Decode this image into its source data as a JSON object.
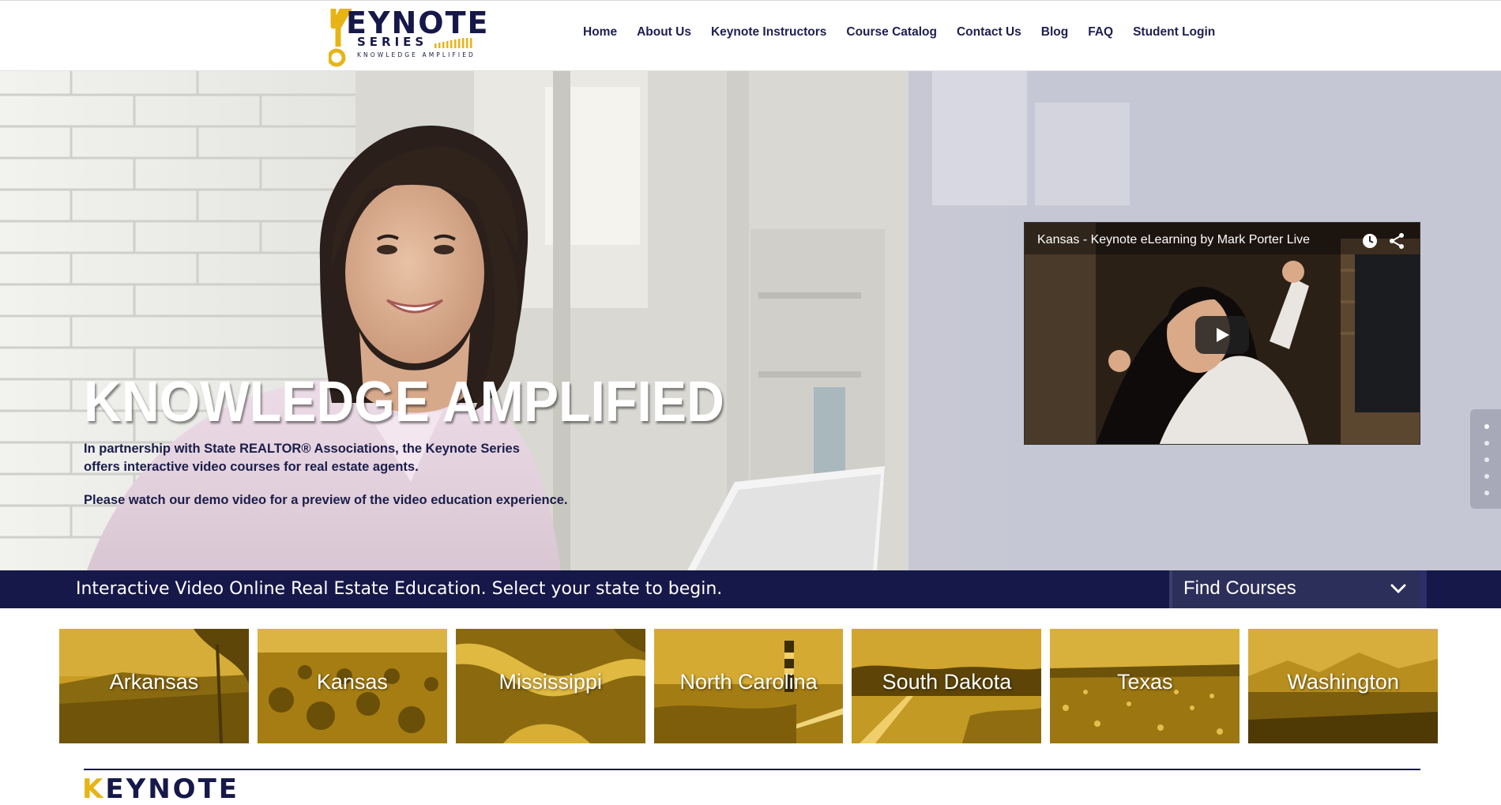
{
  "logo": {
    "word": "EYNOTE",
    "series": "SERIES",
    "tagline": "KNOWLEDGE AMPLIFIED",
    "accent_color": "#e7b416",
    "navy_color": "#16184a"
  },
  "nav": {
    "items": [
      {
        "label": "Home"
      },
      {
        "label": "About Us"
      },
      {
        "label": "Keynote Instructors"
      },
      {
        "label": "Course Catalog"
      },
      {
        "label": "Contact Us"
      },
      {
        "label": "Blog"
      },
      {
        "label": "FAQ"
      },
      {
        "label": "Student Login"
      }
    ]
  },
  "hero": {
    "title": "KNOWLEDGE AMPLIFIED",
    "paragraph1": "In partnership with State REALTOR® Associations, the Keynote Series offers interactive video courses for real estate agents.",
    "paragraph2": "Please watch our demo video for a preview of the video education experience."
  },
  "video": {
    "title": "Kansas - Keynote eLearning by Mark Porter Live",
    "icons": [
      "watch-later-icon",
      "share-icon",
      "play-icon"
    ]
  },
  "slider": {
    "dot_count": 5,
    "active_index": 0
  },
  "state_bar": {
    "text": "Interactive Video Online Real Estate Education. Select your state to begin.",
    "dropdown_label": "Find Courses"
  },
  "states": [
    {
      "name": "Arkansas"
    },
    {
      "name": "Kansas"
    },
    {
      "name": "Mississippi"
    },
    {
      "name": "North Carolina"
    },
    {
      "name": "South Dakota"
    },
    {
      "name": "Texas"
    },
    {
      "name": "Washington"
    }
  ],
  "footer": {
    "logo_k": "K",
    "logo_word": "EYNOTE"
  }
}
